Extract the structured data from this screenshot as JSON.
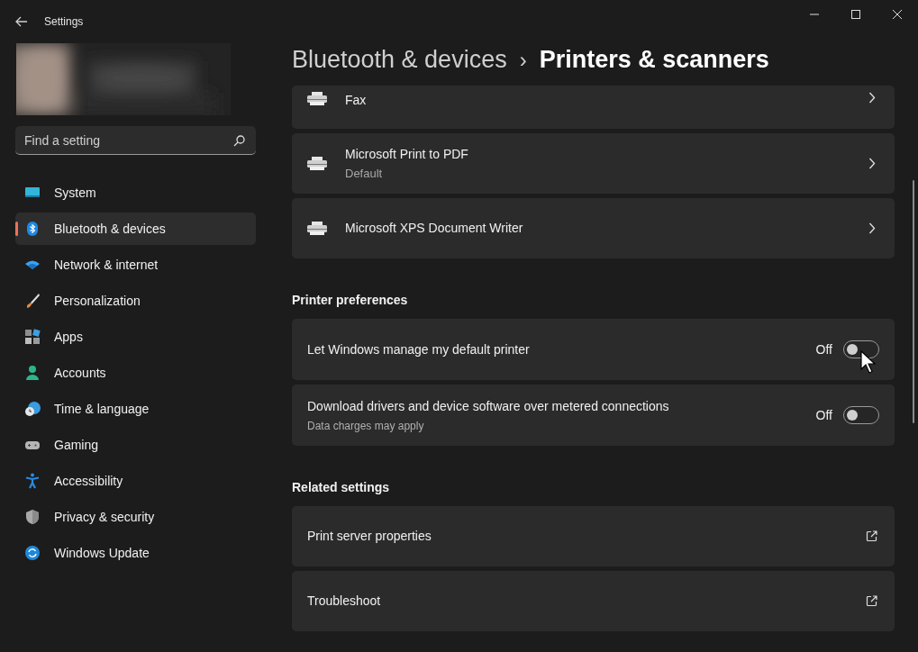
{
  "window": {
    "title": "Settings"
  },
  "search": {
    "placeholder": "Find a setting"
  },
  "sidebar": {
    "items": [
      {
        "label": "System",
        "selected": false
      },
      {
        "label": "Bluetooth & devices",
        "selected": true
      },
      {
        "label": "Network & internet",
        "selected": false
      },
      {
        "label": "Personalization",
        "selected": false
      },
      {
        "label": "Apps",
        "selected": false
      },
      {
        "label": "Accounts",
        "selected": false
      },
      {
        "label": "Time & language",
        "selected": false
      },
      {
        "label": "Gaming",
        "selected": false
      },
      {
        "label": "Accessibility",
        "selected": false
      },
      {
        "label": "Privacy & security",
        "selected": false
      },
      {
        "label": "Windows Update",
        "selected": false
      }
    ]
  },
  "breadcrumb": {
    "parent": "Bluetooth & devices",
    "separator": "›",
    "current": "Printers & scanners"
  },
  "printers": [
    {
      "name": "Fax"
    },
    {
      "name": "Microsoft Print to PDF",
      "subtitle": "Default"
    },
    {
      "name": "Microsoft XPS Document Writer"
    }
  ],
  "printer_preferences": {
    "heading": "Printer preferences",
    "rows": [
      {
        "label": "Let Windows manage my default printer",
        "state_text": "Off",
        "on": false
      },
      {
        "label": "Download drivers and device software over metered connections",
        "description": "Data charges may apply",
        "state_text": "Off",
        "on": false
      }
    ]
  },
  "related_settings": {
    "heading": "Related settings",
    "rows": [
      {
        "label": "Print server properties"
      },
      {
        "label": "Troubleshoot"
      }
    ]
  }
}
